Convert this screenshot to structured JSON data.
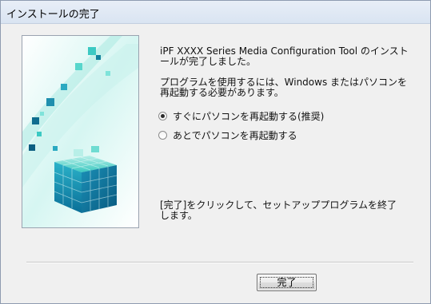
{
  "window": {
    "title": "インストールの完了"
  },
  "message": {
    "line1": "iPF XXXX  Series Media Configuration Tool のインスト",
    "line2": "ールが完了しました。",
    "line3": "プログラムを使用するには、Windows またはパソコンを",
    "line4": "再起動する必要があります。",
    "finish1": "[完了]をクリックして、セットアッププログラムを終了",
    "finish2": "します。"
  },
  "options": [
    {
      "label": "すぐにパソコンを再起動する(推奨)",
      "checked": true
    },
    {
      "label": "あとでパソコンを再起動する",
      "checked": false
    }
  ],
  "buttons": {
    "finish": "完了"
  },
  "colors": {
    "cube_light": "#b8efe8",
    "cube_mid": "#39c7c0",
    "cube_dark": "#0a6f98"
  },
  "icons": {
    "graphic": "installer-cubes-graphic"
  }
}
